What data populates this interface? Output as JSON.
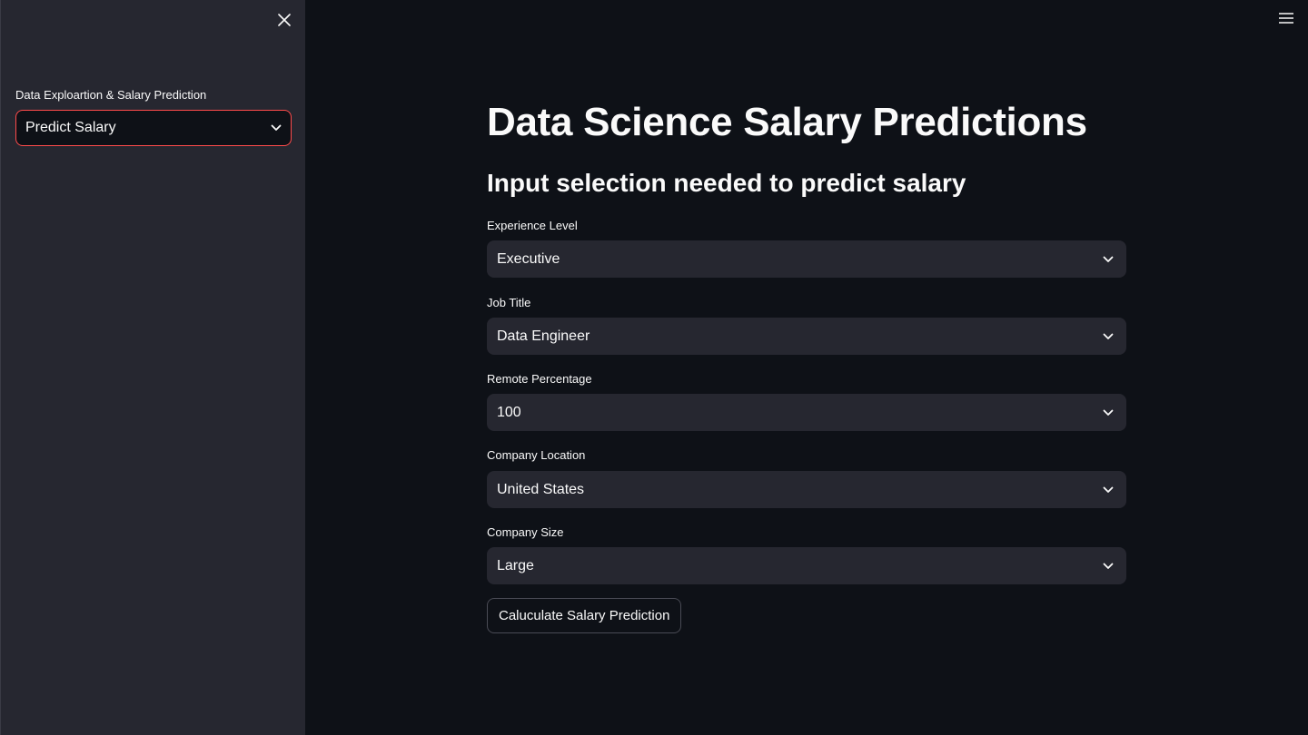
{
  "sidebar": {
    "close_icon": "close-icon",
    "select_label": "Data Exploartion & Salary Prediction",
    "select_value": "Predict Salary",
    "accent_color": "#ff4b4b"
  },
  "header": {
    "menu_icon": "hamburger-menu-icon"
  },
  "main": {
    "title": "Data Science Salary Predictions",
    "subtitle": "Input selection needed to predict salary",
    "fields": [
      {
        "label": "Experience Level",
        "value": "Executive"
      },
      {
        "label": "Job Title",
        "value": "Data Engineer"
      },
      {
        "label": "Remote Percentage",
        "value": "100"
      },
      {
        "label": "Company Location",
        "value": "United States"
      },
      {
        "label": "Company Size",
        "value": "Large"
      }
    ],
    "button_label": "Caluculate Salary Prediction"
  },
  "colors": {
    "background": "#0e1117",
    "sidebar": "#262730",
    "input": "#262730",
    "text": "#fafafa"
  }
}
